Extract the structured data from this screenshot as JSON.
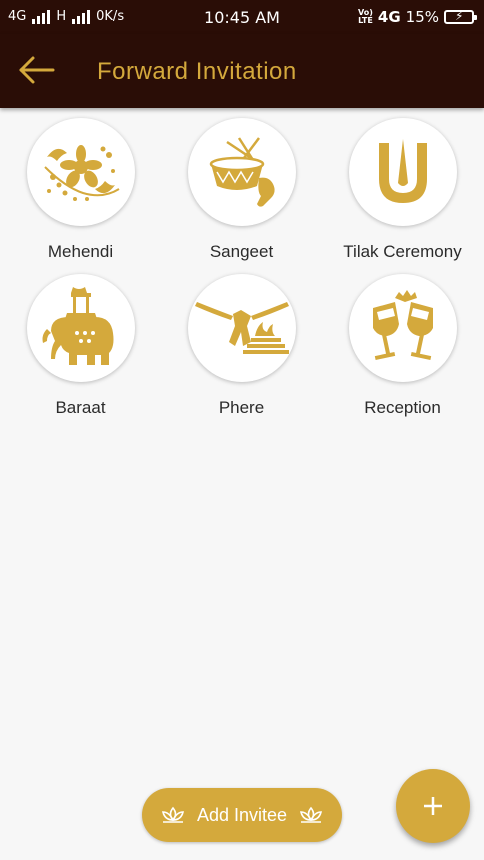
{
  "status_bar": {
    "network1": "4G",
    "network2": "H",
    "speed": "0K/s",
    "time": "10:45 AM",
    "volte": "Vo)\nLTE",
    "network3": "4G",
    "battery_percent": "15%"
  },
  "app_bar": {
    "title": "Forward Invitation",
    "back_icon": "arrow-left-icon"
  },
  "events": [
    {
      "label": "Mehendi",
      "icon": "henna-floral-icon"
    },
    {
      "label": "Sangeet",
      "icon": "dholak-drum-icon"
    },
    {
      "label": "Tilak Ceremony",
      "icon": "tilak-mark-icon"
    },
    {
      "label": "Baraat",
      "icon": "elephant-procession-icon"
    },
    {
      "label": "Phere",
      "icon": "sacred-fire-icon"
    },
    {
      "label": "Reception",
      "icon": "toast-glasses-icon"
    }
  ],
  "add_invitee": {
    "label": "Add Invitee",
    "icon": "lotus-icon"
  },
  "fab": {
    "label": "+",
    "icon": "plus-icon"
  },
  "colors": {
    "header_bg": "#2a0d06",
    "accent_gold": "#d4a93c",
    "page_bg": "#f7f7f7"
  }
}
